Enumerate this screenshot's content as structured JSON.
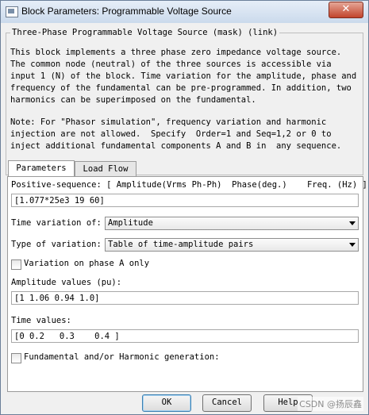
{
  "window": {
    "title": "Block Parameters: Programmable Voltage Source",
    "close_glyph": "✕"
  },
  "group": {
    "legend": "Three-Phase Programmable Voltage Source (mask) (link)",
    "description": "This block implements a three phase zero impedance voltage source.\nThe common node (neutral) of the three sources is accessible via\ninput 1 (N) of the block. Time variation for the amplitude, phase and\nfrequency of the fundamental can be pre-programmed. In addition, two\nharmonics can be superimposed on the fundamental.",
    "note": "Note: For \"Phasor simulation\", frequency variation and harmonic\ninjection are not allowed.  Specify  Order=1 and Seq=1,2 or 0 to\ninject additional fundamental components A and B in  any sequence."
  },
  "tabs": [
    {
      "label": "Parameters",
      "active": true
    },
    {
      "label": "Load Flow",
      "active": false
    }
  ],
  "params": {
    "positive_sequence_label": "Positive-sequence: [ Amplitude(Vrms Ph-Ph)  Phase(deg.)    Freq. (Hz) ]",
    "positive_sequence_value": "[1.077*25e3 19 60]",
    "time_variation_label": "Time variation of:",
    "time_variation_value": "Amplitude",
    "type_of_variation_label": "Type of variation:",
    "type_of_variation_value": "Table of time-amplitude pairs",
    "phase_a_only_label": "Variation on phase A only",
    "phase_a_only_checked": false,
    "amplitude_values_label": "Amplitude values (pu):",
    "amplitude_values_value": "[1 1.06 0.94 1.0]",
    "time_values_label": "Time values:",
    "time_values_value": "[0 0.2   0.3    0.4 ]",
    "harmonic_label": "Fundamental and/or Harmonic generation:",
    "harmonic_checked": false
  },
  "buttons": {
    "ok": "OK",
    "cancel": "Cancel",
    "help": "Help"
  },
  "watermark": "CSDN @扬辰鑫"
}
